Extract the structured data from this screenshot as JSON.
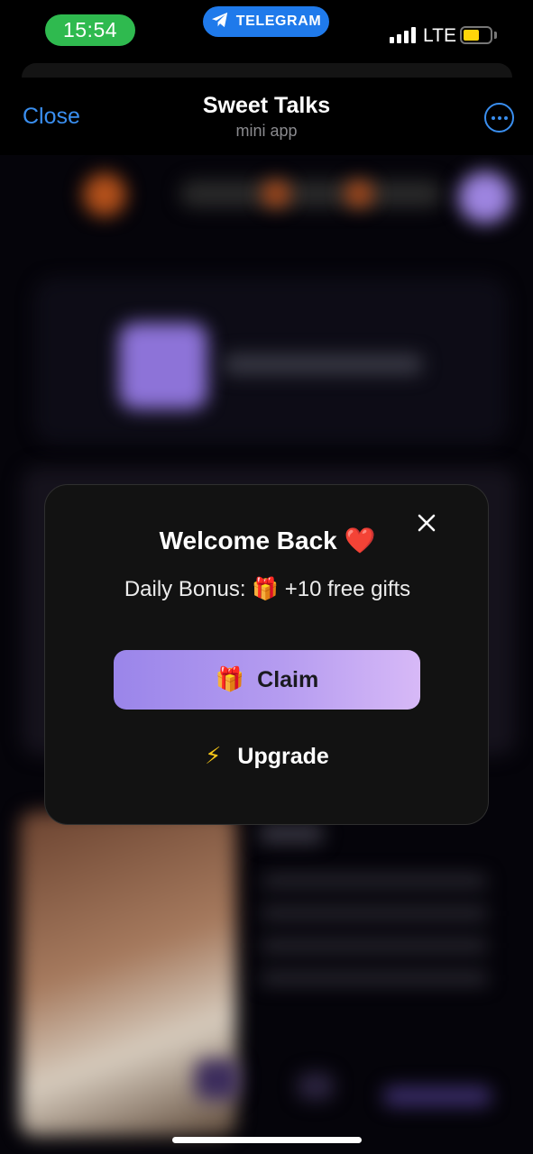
{
  "status_bar": {
    "time": "15:54",
    "active_app": "TELEGRAM",
    "network": "LTE",
    "signal_bars": 4,
    "battery_level": 0.62,
    "colors": {
      "time_pill": "#2fba4f",
      "telegram_pill": "#1f7aeb",
      "battery": "#ffd60a"
    }
  },
  "header": {
    "close_label": "Close",
    "title": "Sweet Talks",
    "subtitle": "mini app",
    "more_icon": "ellipsis-circle-icon",
    "accent": "#3a8ff0"
  },
  "modal": {
    "title": "Welcome Back",
    "title_emoji": "❤️",
    "daily_bonus": "Daily Bonus: 🎁 +10 free gifts",
    "close_icon": "close-icon",
    "claim": {
      "icon": "🎁",
      "label": "Claim"
    },
    "upgrade": {
      "icon": "⚡",
      "label": "Upgrade"
    }
  }
}
